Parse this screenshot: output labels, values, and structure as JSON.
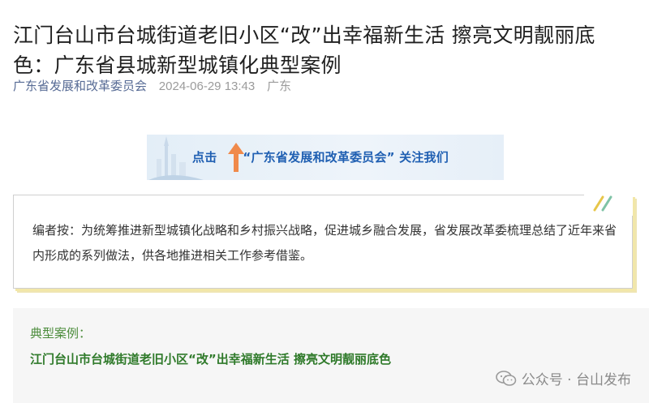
{
  "article": {
    "title": "江门台山市台城街道老旧小区“改”出幸福新生活 擦亮文明靓丽底色：广东省县城新型城镇化典型案例",
    "account": "广东省发展和改革委员会",
    "date": "2024-06-29 13:43",
    "region": "广东"
  },
  "banner": {
    "click_label": "点击",
    "follow_text": "“广东省发展和改革委员会” 关注我们",
    "icon": "up-arrow-icon"
  },
  "note": {
    "text": "编者按：为统筹推进新型城镇化战略和乡村振兴战略，促进城乡融合发展，省发展改革委梳理总结了近年来省内形成的系列做法，供各地推进相关工作参考借鉴。"
  },
  "case": {
    "label": "典型案例：",
    "title": "江门台山市台城街道老旧小区“改”出幸福新生活 擦亮文明靓丽底色"
  },
  "watermark": {
    "text": "公众号 · 台山发布",
    "icon": "wechat-icon"
  },
  "colors": {
    "account_link": "#576b95",
    "banner_text": "#1f5fb2",
    "case_green": "#2f7a2a",
    "accent_yellow": "#f2e7a8"
  }
}
